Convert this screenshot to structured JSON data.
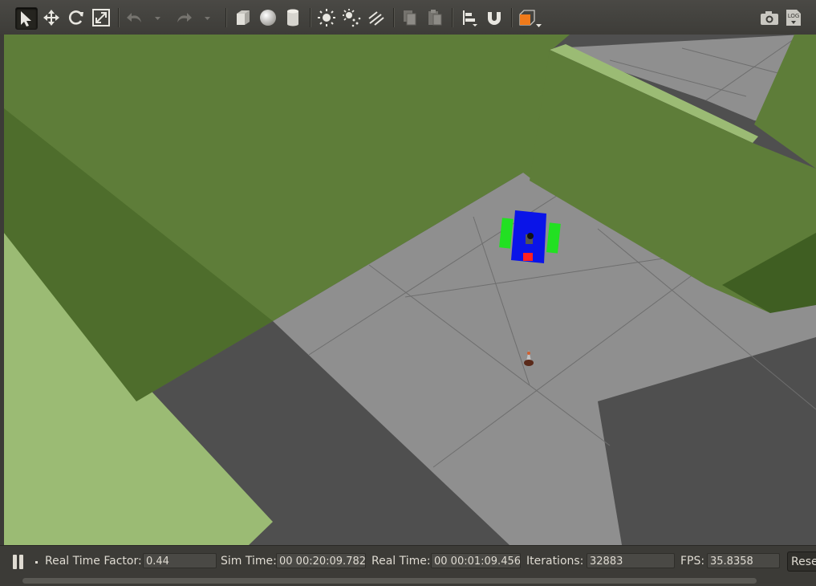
{
  "toolbar": {
    "tools": [
      {
        "name": "select-mode-icon",
        "active": true
      },
      {
        "name": "translate-mode-icon"
      },
      {
        "name": "rotate-mode-icon"
      },
      {
        "name": "scale-mode-icon"
      },
      {
        "name": "undo-icon"
      },
      {
        "name": "undo-dropdown-icon"
      },
      {
        "name": "redo-icon"
      },
      {
        "name": "redo-dropdown-icon"
      },
      {
        "name": "box-shape-icon"
      },
      {
        "name": "sphere-shape-icon"
      },
      {
        "name": "cylinder-shape-icon"
      },
      {
        "name": "point-light-icon"
      },
      {
        "name": "spot-light-icon"
      },
      {
        "name": "directional-light-icon"
      },
      {
        "name": "copy-icon"
      },
      {
        "name": "paste-icon"
      },
      {
        "name": "align-icon"
      },
      {
        "name": "snap-icon"
      },
      {
        "name": "view-angle-icon"
      },
      {
        "name": "screenshot-icon"
      },
      {
        "name": "log-icon"
      }
    ],
    "log_label": "LOG"
  },
  "status": {
    "real_time_factor_label": "Real Time Factor:",
    "real_time_factor": "0.44",
    "sim_time_label": "Sim Time:",
    "sim_time": "00 00:20:09.782",
    "real_time_label": "Real Time:",
    "real_time": "00 00:01:09.456",
    "iterations_label": "Iterations:",
    "iterations": "32883",
    "fps_label": "FPS:",
    "fps": "35.8358",
    "reset_label": "Reset"
  },
  "colors": {
    "wall_green": "#5e7d39",
    "ground_green": "#9bbb74",
    "floor_gray": "#8f8f8f",
    "shadow_gray": "#4f4f4f",
    "robot_body": "#0a14e8",
    "robot_wheels": "#22e022",
    "robot_marker": "#ff2020"
  }
}
